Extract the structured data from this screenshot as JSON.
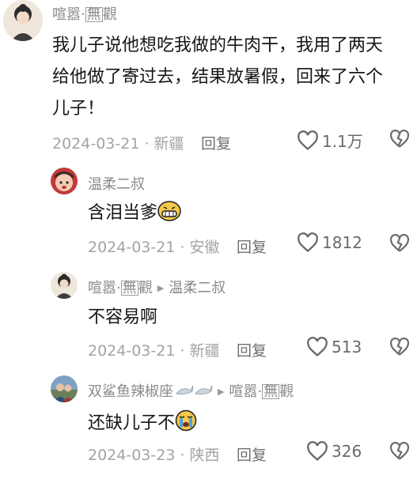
{
  "comments": [
    {
      "author": {
        "name": "喧嚣·",
        "box_text": "無"
      },
      "author_suffix": "觀",
      "content_lines": [
        "我儿子说他想吃我做的牛肉干，我用了两天",
        "给他做了寄过去，结果放暑假，回来了六个",
        "儿子！"
      ],
      "date": "2024-03-21",
      "location": "新疆",
      "reply_label": "回复",
      "likes": "1.1万"
    },
    {
      "author": {
        "name": "温柔二叔"
      },
      "content": "含泪当爹",
      "content_emoji": "grin-emoji",
      "date": "2024-03-21",
      "location": "安徽",
      "reply_label": "回复",
      "likes": "1812"
    },
    {
      "author": {
        "name": "喧嚣·",
        "box_text": "無",
        "suffix": "觀"
      },
      "reply_to": "温柔二叔",
      "content": "不容易啊",
      "date": "2024-03-21",
      "location": "新疆",
      "reply_label": "回复",
      "likes": "513"
    },
    {
      "author": {
        "name": "双鲨鱼辣椒座",
        "shark_icons": "shark-icon"
      },
      "reply_to_name": "喧嚣·",
      "reply_to_box": "無",
      "reply_to_suffix": "觀",
      "content": "还缺儿子不",
      "content_emoji": "crying-emoji",
      "date": "2024-03-23",
      "location": "陕西",
      "reply_label": "回复",
      "likes": "326"
    }
  ],
  "separator": " · ",
  "colors": {
    "text": "#161616",
    "muted": "#a3a3a3",
    "icon": "#6a6a6a",
    "emoji": "#f6c84a"
  }
}
